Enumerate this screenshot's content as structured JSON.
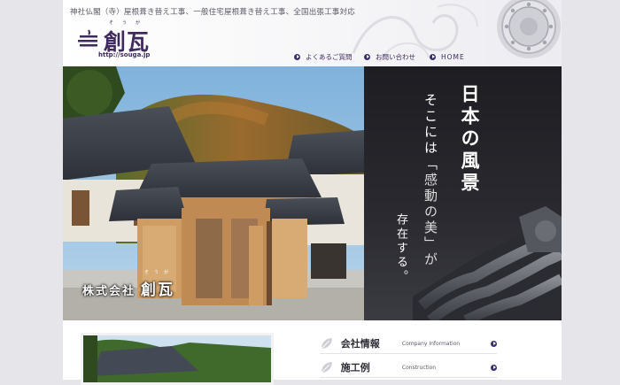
{
  "header": {
    "tagline": "神社仏閣（寺）屋根葺き替え工事、一般住宅屋根葺き替え工事、全国出張工事対応",
    "logo_text": "創瓦",
    "logo_ruby": "そうが",
    "url": "http://souga.jp"
  },
  "nav": [
    {
      "label": "よくあるご質問"
    },
    {
      "label": "お問い合わせ"
    },
    {
      "label": "HOME"
    }
  ],
  "hero": {
    "company_prefix": "株式会社",
    "company_name": "創瓦",
    "company_ruby": "そうが",
    "copy_line1": "日本の風景",
    "copy_line2_pre": "そこには",
    "copy_line2_quote": "「感動の美」が",
    "copy_line3": "存在する。"
  },
  "menu": [
    {
      "jp": "会社情報",
      "en": "Company Information",
      "icon": "leaf-icon"
    },
    {
      "jp": "施工例",
      "en": "Construction",
      "icon": "leaf-icon"
    }
  ],
  "colors": {
    "accent": "#3a2f6e",
    "hero_dark": "#1d1d22",
    "background": "#e6e6ea"
  }
}
